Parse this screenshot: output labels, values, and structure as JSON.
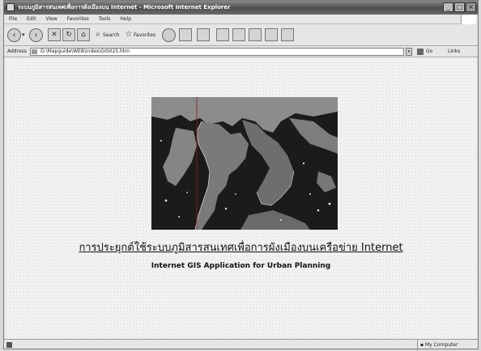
{
  "window": {
    "title": "ระบบภูมิสารสนเทศเพื่อการผังเมืองบน Internet - Microsoft Internet Explorer",
    "min_label": "_",
    "max_label": "□",
    "close_label": "×"
  },
  "menu": {
    "items": [
      "File",
      "Edit",
      "View",
      "Favorites",
      "Tools",
      "Help"
    ]
  },
  "toolbar": {
    "back_icon": "‹",
    "back_dropdown": "▾",
    "forward_icon": "›",
    "search_label": "Search",
    "favorites_label": "Favorites"
  },
  "address": {
    "label": "Address",
    "url": "D:\\Mapguide\\WEB\\index\\GIS025.htm",
    "go_label": "Go",
    "links_label": "Links"
  },
  "page": {
    "thai_title": "การประยุกต์ใช้ระบบภูมิสารสนเทศเพื่อการผังเมืองบนเครือข่าย Internet",
    "english_title": "Internet GIS Application for Urban Planning"
  },
  "status": {
    "zone_label": "My Computer"
  },
  "colors": {
    "title_bar": "#4e4e4e",
    "map_background": "#1b1b1b",
    "land": "#8c8c8c"
  }
}
